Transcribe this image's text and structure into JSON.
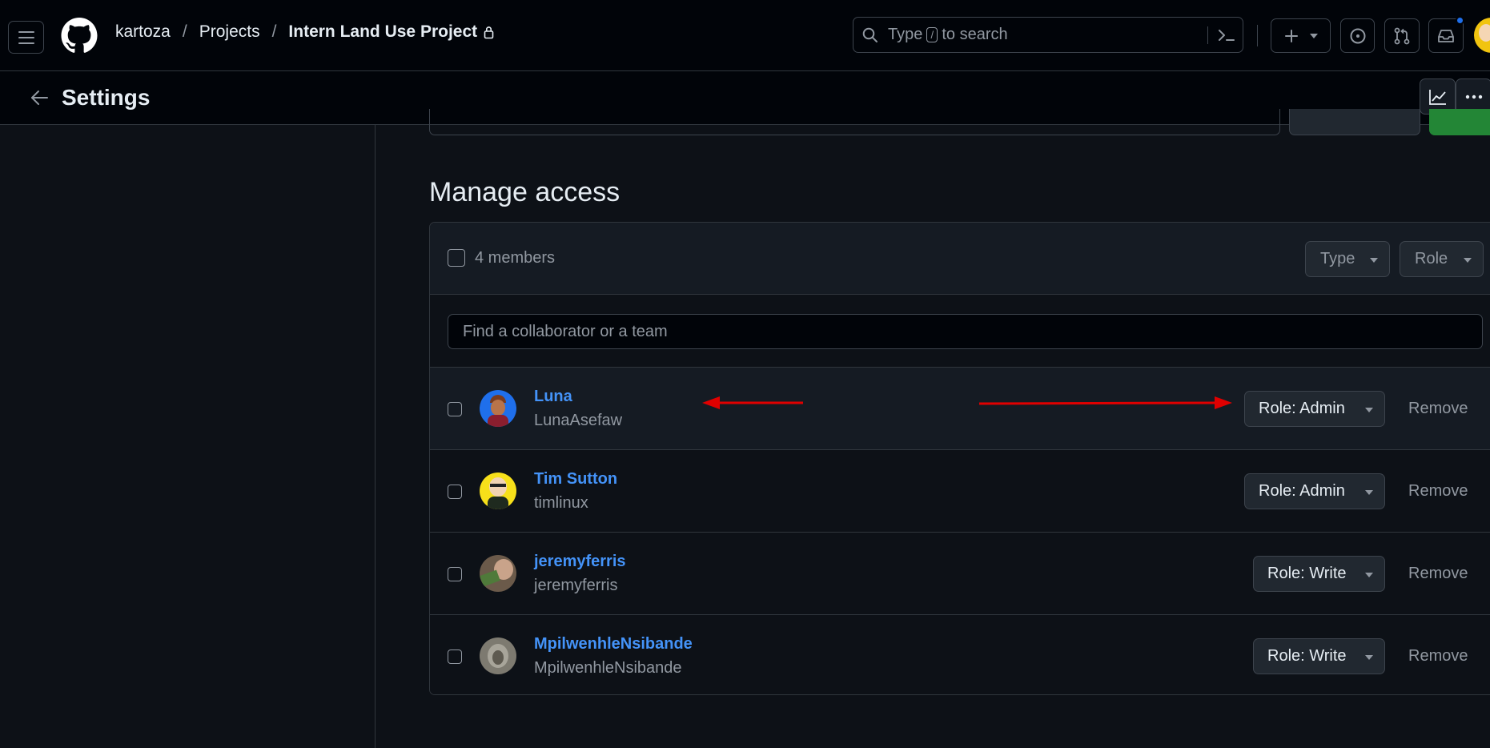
{
  "header": {
    "breadcrumb": {
      "owner": "kartoza",
      "section": "Projects",
      "project": "Intern Land Use Project"
    },
    "search": {
      "prefix": "Type",
      "key": "/",
      "suffix": "to search"
    },
    "notification_dot_color": "#1f6feb"
  },
  "subbar": {
    "title": "Settings"
  },
  "main": {
    "title": "Manage access",
    "members_count_label": "4 members",
    "filters": {
      "type_label": "Type",
      "role_label": "Role"
    },
    "find_placeholder": "Find a collaborator or a team",
    "members": [
      {
        "name": "Luna",
        "login": "LunaAsefaw",
        "role": "Role: Admin",
        "remove": "Remove"
      },
      {
        "name": "Tim Sutton",
        "login": "timlinux",
        "role": "Role: Admin",
        "remove": "Remove"
      },
      {
        "name": "jeremyferris",
        "login": "jeremyferris",
        "role": "Role: Write",
        "remove": "Remove"
      },
      {
        "name": "MpilwenhleNsibande",
        "login": "MpilwenhleNsibande",
        "role": "Role: Write",
        "remove": "Remove"
      }
    ]
  },
  "colors": {
    "link": "#4493f8",
    "annotation_arrow": "#e00000",
    "primary_green": "#238636"
  },
  "icons": [
    "hamburger-icon",
    "github-logo-icon",
    "lock-icon",
    "search-icon",
    "command-palette-icon",
    "plus-icon",
    "issues-icon",
    "pull-requests-icon",
    "inbox-icon",
    "back-arrow-icon",
    "graph-icon",
    "kebab-icon"
  ]
}
